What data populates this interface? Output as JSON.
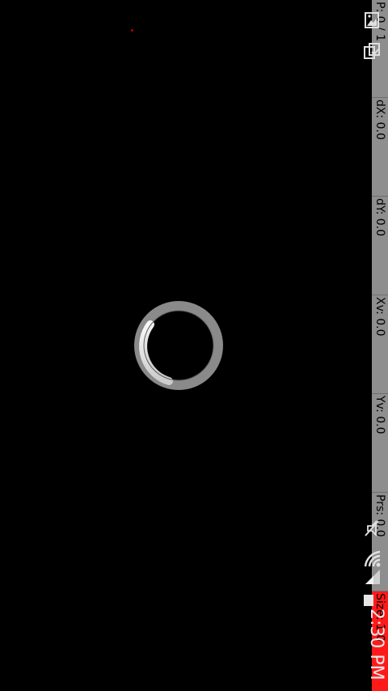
{
  "pointer_overlay": {
    "pointer": "P: 0 / 1",
    "dx": "dX: 0.0",
    "dy": "dY: 0.0",
    "xv": "Xv: 0.0",
    "yv": "Yv: 0.0",
    "prs": "Prs: 0.0",
    "size": "Size: 1.0"
  },
  "status_bar": {
    "time": "2:30 PM",
    "icons": [
      "gallery-icon",
      "sync-icon",
      "mute-icon",
      "wifi-icon",
      "signal-icon",
      "battery-icon"
    ]
  },
  "spinner": {
    "state": "loading"
  },
  "colors": {
    "background": "#000000",
    "overlay_strip": "#8e8e8e",
    "size_highlight": "#ff1a1a",
    "spinner_track": "#8a8a8a",
    "spinner_arc": "#ffffff"
  }
}
